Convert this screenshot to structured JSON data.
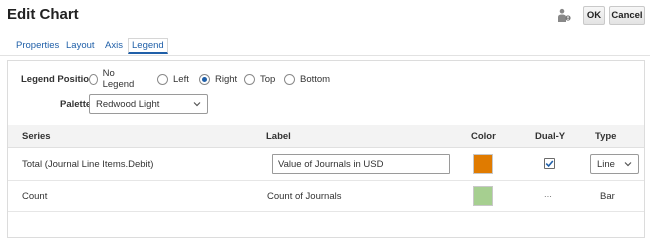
{
  "header": {
    "title": "Edit Chart",
    "ok_label": "OK",
    "cancel_label": "Cancel",
    "help_icon": "help-person-icon"
  },
  "tabs": [
    {
      "label": "Properties"
    },
    {
      "label": "Layout"
    },
    {
      "label": "Axis"
    },
    {
      "label": "Legend",
      "active": true
    }
  ],
  "legend_position": {
    "label": "Legend Position",
    "options": [
      "No Legend",
      "Left",
      "Right",
      "Top",
      "Bottom"
    ],
    "selected": "Right"
  },
  "palette": {
    "label": "Palette",
    "value": "Redwood Light"
  },
  "grid": {
    "headers": [
      "Series",
      "Label",
      "Color",
      "Dual-Y",
      "Type"
    ],
    "rows": [
      {
        "series": "Total (Journal Line Items.Debit)",
        "label": "Value of Journals in USD",
        "color": "#e07b00",
        "dual_y": true,
        "type": "Line"
      },
      {
        "series": "Count",
        "label": "Count of Journals",
        "color": "#a6cf90",
        "dual_y_display": "...",
        "type": "Bar"
      }
    ]
  },
  "colors": {
    "link": "#1f5fa8",
    "accent": "#1f5fa8"
  }
}
